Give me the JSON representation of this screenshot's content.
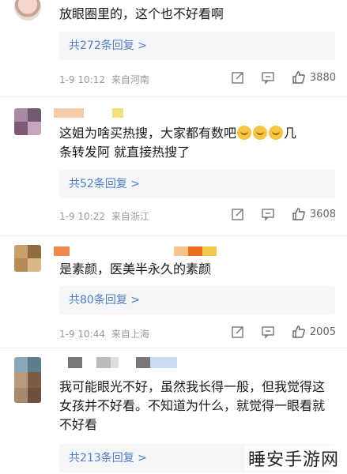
{
  "comments": [
    {
      "text": "放眼圈里的，这个也不好看啊",
      "reply_label": "共272条回复 >",
      "date": "1-9 10:12",
      "location": "来自河南",
      "likes": "3880"
    },
    {
      "text_part1": "这姐为啥买热搜，大家都有数吧",
      "text_part2": "几",
      "text_line2": "条转发阿 就直接热搜了",
      "reply_label": "共52条回复 >",
      "date": "1-9 10:22",
      "location": "来自浙江",
      "likes": "3608"
    },
    {
      "text": "是素颜，医美半永久的素颜",
      "reply_label": "共80条回复 >",
      "date": "1-9 10:44",
      "location": "来自上海",
      "likes": "2005"
    },
    {
      "text": "我可能眼光不好，虽然我长得一般，但我觉得这女孩并不好看。不知道为什么，就觉得一眼看就不好看",
      "reply_label": "共213条回复 >"
    }
  ],
  "watermark": "睡安手游网",
  "colors": {
    "link": "#4f7dc9",
    "meta": "#999999",
    "reply_bg": "#f5f6f8"
  }
}
